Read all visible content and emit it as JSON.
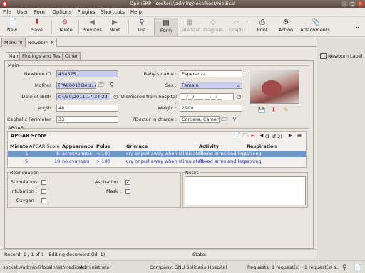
{
  "window": {
    "title": "OpenERP - socket://admin@localhost/medical"
  },
  "menubar": [
    "File",
    "User",
    "Form",
    "Options",
    "Plugins",
    "Shortcuts",
    "Help"
  ],
  "toolbar": {
    "new": "New",
    "save": "Save",
    "delete": "Delete",
    "previous": "Previous",
    "next": "Next",
    "list": "List",
    "form": "Form",
    "calendar": "Calendar",
    "diagram": "Diagram",
    "graph": "Graph",
    "print": "Print",
    "action": "Action",
    "attachments": "Attachments"
  },
  "doc_tabs": {
    "menu": "Menu",
    "newborn": "Newborn"
  },
  "sidebar": {
    "newborn_label": "Newborn Label"
  },
  "subtabs": [
    "Main",
    "Findings and Tests",
    "Other"
  ],
  "main": {
    "group_label": "Main",
    "newborn_id_label": "Newborn ID :",
    "newborn_id": "454575",
    "mother_label": "Mother :",
    "mother": "[PAC001] Betz, A",
    "dob_label": "Date of Birth :",
    "dob": "04/30/2011 17:34:23",
    "length_label": "Length :",
    "length": "48",
    "cephalic_label": "Cephalic Perimeter :",
    "cephalic": "33",
    "baby_name_label": "Baby's name :",
    "baby_name": "Esperanza",
    "sex_label": "Sex :",
    "sex": "Female",
    "dismissed_label": "Dismissed from hospital :",
    "dismissed": "__/__/____ __:__:__",
    "weight_label": "Weight :",
    "weight": "2900",
    "doctor_label": "?Doctor in charge :",
    "doctor": "Cordara, Cameron"
  },
  "apgar": {
    "group_label": "APGAR",
    "title": "APGAR Score",
    "pager": "(1 of 2)",
    "columns": [
      "Minute",
      "APGAR Score",
      "Appearance",
      "Pulse",
      "Grimace",
      "Activity",
      "Respiration"
    ],
    "rows": [
      [
        "1",
        "8",
        "acrocyanosis",
        "< 100",
        "cry or pull away when stimulated",
        "flexed arms and legs",
        "strong"
      ],
      [
        "5",
        "10",
        "no cyanosis",
        "> 100",
        "cry or pull away when stimulated",
        "flexed arms and legs",
        "strong"
      ]
    ]
  },
  "reanimation": {
    "group_label": "Reanimation",
    "stimulation": "Stimulation :",
    "intubation": "Intubation :",
    "oxygen": "Oxygen :",
    "aspiration": "Aspiration :",
    "mask": "Mask :",
    "aspiration_checked": true
  },
  "notes": {
    "group_label": "Notes"
  },
  "status": {
    "record": "Record: 1 / 1 of 1 - Editing document (id: 1)",
    "state": "State:",
    "connection": "socket://admin@localhost/medical",
    "user": "Administrator",
    "company": "Company:  GNU Solidario Hospital",
    "requests": "Requests:  1 request(s) - 1 request(s) s..."
  }
}
